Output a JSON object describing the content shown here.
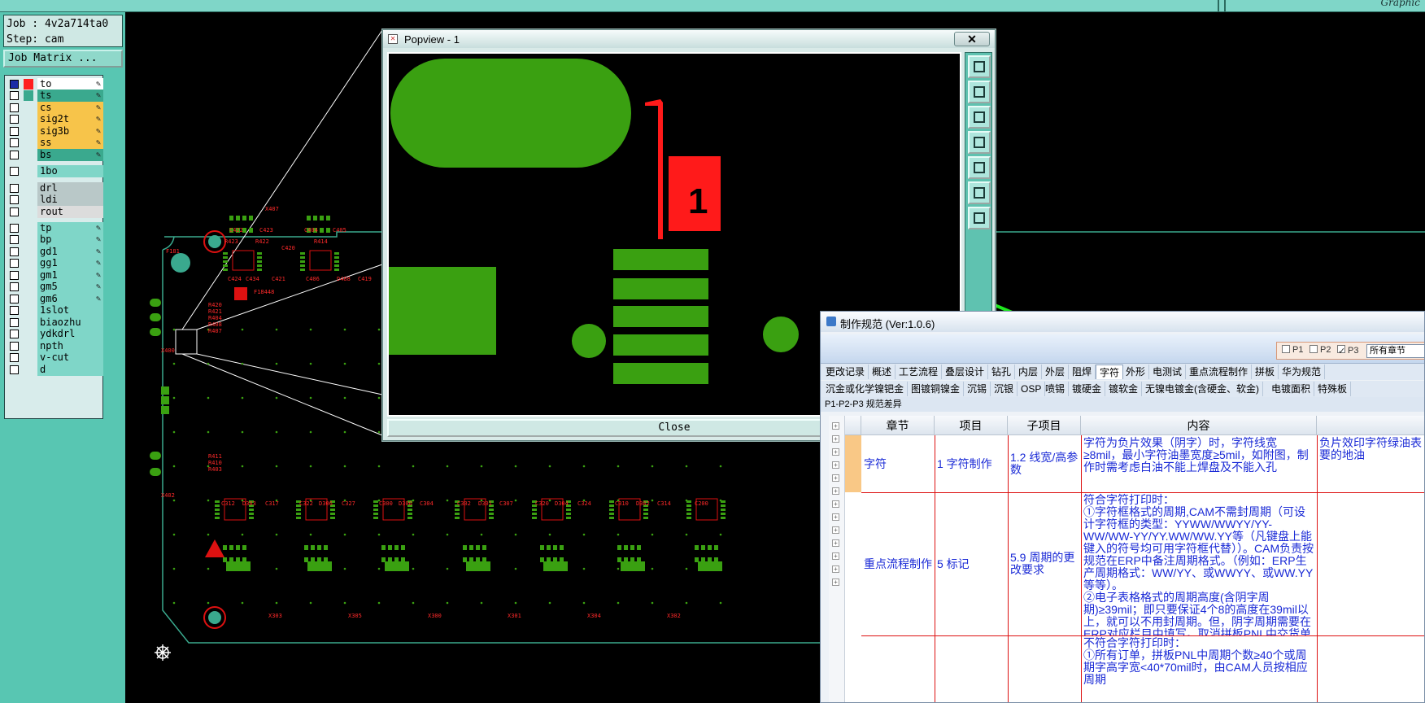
{
  "topbar": {
    "graphic_label": "Graphic"
  },
  "left_panel": {
    "job_line": "Job : 4v2a714ta0",
    "step_line": "Step: cam",
    "job_matrix_button": "Job Matrix ...",
    "layers": [
      {
        "name": "to",
        "color": "#ff2020",
        "style": "w",
        "checked": true
      },
      {
        "name": "ts",
        "color": "#3aa98e",
        "style": "g",
        "checked": false
      },
      {
        "name": "cs",
        "color": "",
        "style": "y",
        "checked": false
      },
      {
        "name": "sig2t",
        "color": "",
        "style": "y",
        "checked": false
      },
      {
        "name": "sig3b",
        "color": "",
        "style": "y",
        "checked": false
      },
      {
        "name": "ss",
        "color": "",
        "style": "y",
        "checked": false
      },
      {
        "name": "bs",
        "color": "",
        "style": "g",
        "checked": false
      },
      {
        "name": "1bo",
        "color": "",
        "style": "b",
        "checked": false
      },
      {
        "name": "drl",
        "color": "",
        "style": "gr",
        "checked": false
      },
      {
        "name": "ldi",
        "color": "",
        "style": "gr",
        "checked": false
      },
      {
        "name": "rout",
        "color": "",
        "style": "lg",
        "checked": false
      },
      {
        "name": "tp",
        "color": "",
        "style": "b",
        "checked": false
      },
      {
        "name": "bp",
        "color": "",
        "style": "b",
        "checked": false
      },
      {
        "name": "gd1",
        "color": "",
        "style": "b",
        "checked": false
      },
      {
        "name": "gg1",
        "color": "",
        "style": "b",
        "checked": false
      },
      {
        "name": "gm1",
        "color": "",
        "style": "b",
        "checked": false
      },
      {
        "name": "gm5",
        "color": "",
        "style": "b",
        "checked": false
      },
      {
        "name": "gm6",
        "color": "",
        "style": "b",
        "checked": false
      },
      {
        "name": "1slot",
        "color": "",
        "style": "b",
        "checked": false
      },
      {
        "name": "biaozhu",
        "color": "",
        "style": "b",
        "checked": false
      },
      {
        "name": "ydkdrl",
        "color": "",
        "style": "b",
        "checked": false
      },
      {
        "name": "npth",
        "color": "",
        "style": "b",
        "checked": false
      },
      {
        "name": "v-cut",
        "color": "",
        "style": "b",
        "checked": false
      },
      {
        "name": "d",
        "color": "",
        "style": "b",
        "checked": false
      }
    ]
  },
  "popview": {
    "title": "Popview - 1",
    "close_x": "✕",
    "close_button": "Close",
    "pad_label": "1"
  },
  "board_labels": [
    "X407",
    "C422",
    "C423",
    "C404",
    "C405",
    "R423",
    "R422",
    "C420",
    "R414",
    "C424",
    "C434",
    "C421",
    "C406",
    "D488",
    "C419",
    "F181",
    "F18448",
    "R420",
    "R421",
    "R404",
    "R408",
    "R407",
    "X400",
    "R411",
    "R410",
    "R403",
    "X402",
    "C312",
    "D303",
    "C317",
    "C322",
    "D306",
    "C327",
    "C300",
    "D300",
    "C304",
    "C302",
    "D301",
    "C307",
    "C320",
    "D304",
    "C324",
    "C310",
    "D302",
    "C314",
    "C200",
    "X303",
    "X305",
    "X300",
    "X301",
    "X304",
    "X302"
  ],
  "spec": {
    "title": "制作规范 (Ver:1.0.6)",
    "filters": {
      "p1": "P1",
      "p2": "P2",
      "p3": "P3",
      "chapter_select": "所有章节"
    },
    "tabs_row1": [
      "更改记录",
      "概述",
      "工艺流程",
      "叠层设计",
      "钻孔",
      "内层",
      "外层",
      "阻焊",
      "字符",
      "外形",
      "电测试",
      "重点流程制作",
      "拼板",
      "华为规范"
    ],
    "tabs_row2": [
      "沉金或化学镍钯金",
      "图镀铜镍金",
      "沉锡",
      "沉银",
      "OSP",
      "喷锡",
      "镀硬金",
      "镀软金",
      "无镍电镀金(含硬金、软金)",
      "电镀面积",
      "特殊板"
    ],
    "p3_diff": "P1-P2-P3 规范差异",
    "columns": [
      "章节",
      "项目",
      "子项目",
      "内容",
      ""
    ],
    "rows": [
      {
        "chapter": "字符",
        "item": "1 字符制作",
        "sub": "1.2 线宽/高参数",
        "content": "字符为负片效果（阴字）时，字符线宽≥8mil，最小字符油墨宽度≥5mil，如附图，制作时需考虑白油不能上焊盘及不能入孔",
        "extra": "负片效印字符绿油表要的地油"
      },
      {
        "chapter": "重点流程制作",
        "item": "5 标记",
        "sub": "5.9 周期的更改要求",
        "content": "符合字符打印时：\n①字符框格式的周期,CAM不需封周期（可设计字符框的类型：YYWW/WWYY/YY-WW/WW-YY/YY.WW/WW.YY等（凡键盘上能键入的符号均可用字符框代替））。CAM负责按规范在ERP中备注周期格式。（例如：ERP生产周期格式：WW/YY、或WWYY、或WW.YY等等）。\n②电子表格格式的周期高度(含阴字周期)≥39mil；即只要保证4个8的高度在39mil以上，就可以不用封周期。但，阴字周期需要在ERP对应栏目中填写。取消拼板PNL中交货单元板数量的限制。",
        "extra": ""
      },
      {
        "chapter": "",
        "item": "",
        "sub": "",
        "content": "不符合字符打印时：\n①所有订单，拼板PNL中周期个数≥40个或周期字高字宽<40*70mil时，由CAM人员按相应周期",
        "extra": ""
      }
    ]
  }
}
